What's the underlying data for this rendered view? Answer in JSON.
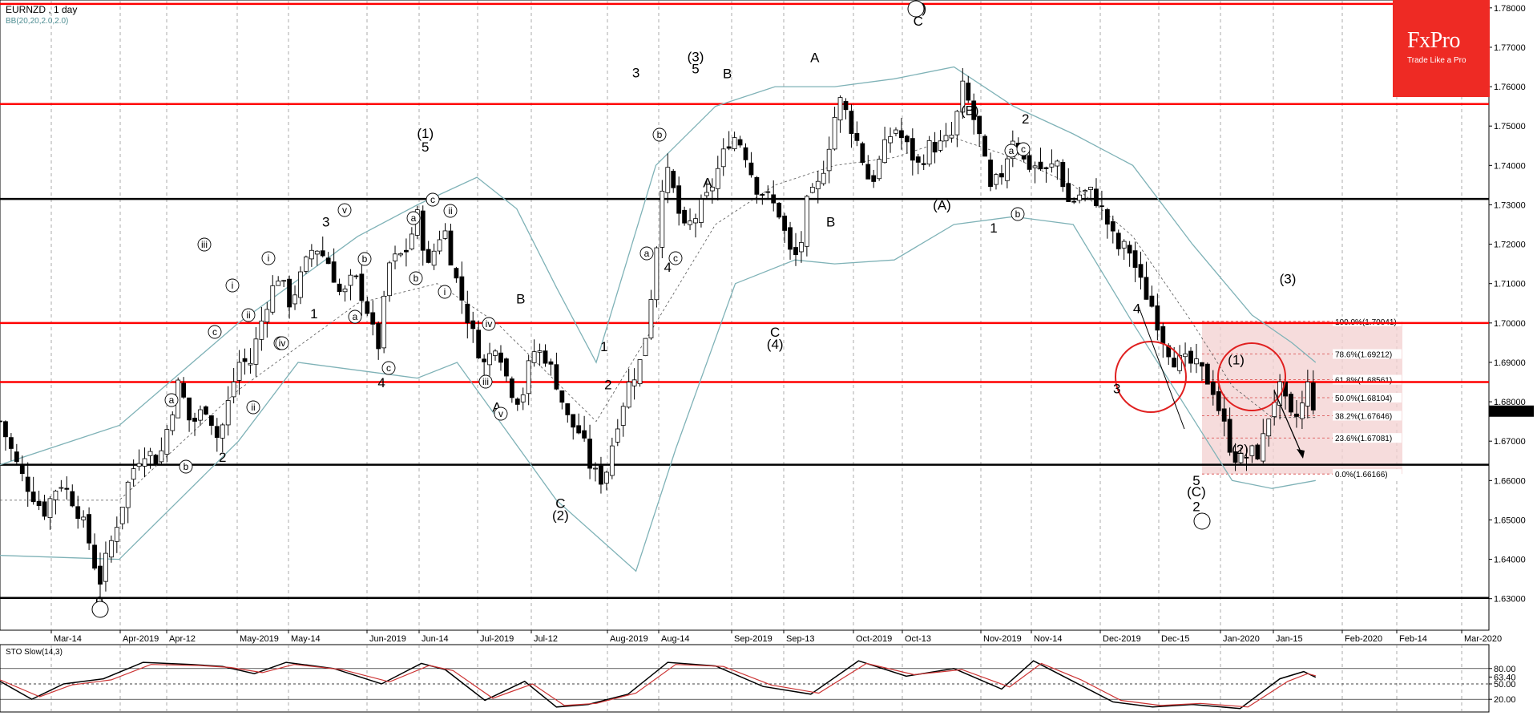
{
  "header": {
    "title": "EURNZD , 1 day",
    "indicator": "BB(20,20,2.0,2.0)"
  },
  "logo": {
    "brand": "FxPro",
    "tagline": "Trade Like a Pro"
  },
  "colors": {
    "bull": "#ffffff",
    "bear": "#000000",
    "bollinger": "#7fb2b7",
    "midline": "#555555",
    "resistance": "#ff0000",
    "support": "#000000",
    "fib_zone": "#f3d0d0",
    "stoch_k": "#000000",
    "stoch_d": "#cc3333",
    "logo_bg": "#ee2a24",
    "current_price_bg": "#000000"
  },
  "chart_data": [
    {
      "type": "candlestick",
      "title": "EURNZD , 1 day",
      "xlabel": "",
      "ylabel": "",
      "x_tick_labels": [
        "Mar-14",
        "Apr-2019",
        "Apr-12",
        "May-2019",
        "May-14",
        "Jun-2019",
        "Jun-14",
        "Jul-2019",
        "Jul-12",
        "Aug-2019",
        "Aug-14",
        "Sep-2019",
        "Sep-13",
        "Oct-2019",
        "Oct-13",
        "Nov-2019",
        "Nov-14",
        "Dec-2019",
        "Dec-15",
        "Jan-2020",
        "Jan-15",
        "Feb-2020",
        "Feb-14",
        "Mar-2020"
      ],
      "y_tick_labels": [
        "1.78000",
        "1.77000",
        "1.76000",
        "1.75000",
        "1.74000",
        "1.73000",
        "1.72000",
        "1.71000",
        "1.70000",
        "1.69000",
        "1.68000",
        "1.67000",
        "1.66000",
        "1.65000",
        "1.64000",
        "1.63000"
      ],
      "ylim": [
        1.622,
        1.782
      ],
      "current_price": "1.67762",
      "grid": true,
      "red_levels": [
        1.781,
        1.7556,
        1.7,
        1.685
      ],
      "black_levels": [
        1.7315,
        1.664,
        1.6302
      ],
      "close_path": [
        [
          0,
          1.675
        ],
        [
          5,
          1.662
        ],
        [
          11,
          1.652
        ],
        [
          15,
          1.66
        ],
        [
          19,
          1.654
        ],
        [
          22,
          1.646
        ],
        [
          25,
          1.634
        ],
        [
          29,
          1.648
        ],
        [
          33,
          1.662
        ],
        [
          36,
          1.668
        ],
        [
          40,
          1.665
        ],
        [
          45,
          1.685
        ],
        [
          48,
          1.674
        ],
        [
          52,
          1.679
        ],
        [
          55,
          1.67
        ],
        [
          60,
          1.69
        ],
        [
          63,
          1.69
        ],
        [
          67,
          1.705
        ],
        [
          70,
          1.712
        ],
        [
          73,
          1.705
        ],
        [
          77,
          1.715
        ],
        [
          79,
          1.72
        ],
        [
          83,
          1.715
        ],
        [
          86,
          1.706
        ],
        [
          89,
          1.712
        ],
        [
          92,
          1.705
        ],
        [
          95,
          1.693
        ],
        [
          98,
          1.715
        ],
        [
          102,
          1.718
        ],
        [
          105,
          1.727
        ],
        [
          108,
          1.713
        ],
        [
          110,
          1.722
        ],
        [
          112,
          1.723
        ],
        [
          115,
          1.71
        ],
        [
          119,
          1.697
        ],
        [
          122,
          1.689
        ],
        [
          125,
          1.696
        ],
        [
          128,
          1.684
        ],
        [
          131,
          1.68
        ],
        [
          134,
          1.693
        ],
        [
          137,
          1.692
        ],
        [
          140,
          1.685
        ],
        [
          143,
          1.675
        ],
        [
          146,
          1.672
        ],
        [
          149,
          1.662
        ],
        [
          152,
          1.66
        ],
        [
          155,
          1.674
        ],
        [
          158,
          1.684
        ],
        [
          161,
          1.69
        ],
        [
          163,
          1.7
        ],
        [
          165,
          1.718
        ],
        [
          167,
          1.74
        ],
        [
          169,
          1.735
        ],
        [
          172,
          1.723
        ],
        [
          175,
          1.727
        ],
        [
          178,
          1.732
        ],
        [
          181,
          1.74
        ],
        [
          184,
          1.748
        ],
        [
          187,
          1.745
        ],
        [
          190,
          1.735
        ],
        [
          193,
          1.732
        ],
        [
          196,
          1.728
        ],
        [
          199,
          1.717
        ],
        [
          201,
          1.717
        ],
        [
          203,
          1.73
        ],
        [
          206,
          1.735
        ],
        [
          208,
          1.743
        ],
        [
          211,
          1.757
        ],
        [
          213,
          1.753
        ],
        [
          216,
          1.745
        ],
        [
          219,
          1.735
        ],
        [
          222,
          1.743
        ],
        [
          225,
          1.75
        ],
        [
          228,
          1.745
        ],
        [
          231,
          1.74
        ],
        [
          234,
          1.745
        ],
        [
          237,
          1.745
        ],
        [
          240,
          1.748
        ],
        [
          242,
          1.76
        ],
        [
          244,
          1.755
        ],
        [
          247,
          1.745
        ],
        [
          249,
          1.733
        ],
        [
          252,
          1.738
        ],
        [
          255,
          1.748
        ],
        [
          258,
          1.74
        ],
        [
          261,
          1.74
        ],
        [
          263,
          1.738
        ],
        [
          266,
          1.741
        ],
        [
          269,
          1.73
        ],
        [
          272,
          1.733
        ],
        [
          275,
          1.733
        ],
        [
          278,
          1.727
        ],
        [
          281,
          1.719
        ],
        [
          284,
          1.719
        ],
        [
          287,
          1.71
        ],
        [
          290,
          1.704
        ],
        [
          293,
          1.695
        ],
        [
          296,
          1.69
        ],
        [
          299,
          1.69
        ],
        [
          302,
          1.688
        ],
        [
          305,
          1.684
        ],
        [
          307,
          1.677
        ],
        [
          310,
          1.667
        ],
        [
          312,
          1.665
        ],
        [
          315,
          1.667
        ],
        [
          317,
          1.667
        ],
        [
          320,
          1.68
        ],
        [
          322,
          1.683
        ],
        [
          325,
          1.675
        ],
        [
          327,
          1.677
        ],
        [
          329,
          1.684
        ],
        [
          331,
          1.6776
        ]
      ],
      "bollinger_upper": [
        [
          0,
          1.664
        ],
        [
          30,
          1.674
        ],
        [
          60,
          1.7
        ],
        [
          90,
          1.722
        ],
        [
          105,
          1.73
        ],
        [
          120,
          1.737
        ],
        [
          130,
          1.729
        ],
        [
          140,
          1.709
        ],
        [
          150,
          1.69
        ],
        [
          165,
          1.74
        ],
        [
          180,
          1.755
        ],
        [
          195,
          1.76
        ],
        [
          210,
          1.76
        ],
        [
          225,
          1.762
        ],
        [
          240,
          1.765
        ],
        [
          255,
          1.755
        ],
        [
          270,
          1.748
        ],
        [
          285,
          1.74
        ],
        [
          300,
          1.72
        ],
        [
          315,
          1.702
        ],
        [
          325,
          1.695
        ],
        [
          331,
          1.69
        ]
      ],
      "bollinger_lower": [
        [
          0,
          1.641
        ],
        [
          30,
          1.64
        ],
        [
          45,
          1.655
        ],
        [
          60,
          1.67
        ],
        [
          75,
          1.69
        ],
        [
          90,
          1.688
        ],
        [
          105,
          1.686
        ],
        [
          115,
          1.69
        ],
        [
          125,
          1.676
        ],
        [
          140,
          1.655
        ],
        [
          160,
          1.637
        ],
        [
          170,
          1.668
        ],
        [
          185,
          1.71
        ],
        [
          200,
          1.716
        ],
        [
          210,
          1.715
        ],
        [
          225,
          1.716
        ],
        [
          240,
          1.725
        ],
        [
          255,
          1.727
        ],
        [
          270,
          1.725
        ],
        [
          285,
          1.7
        ],
        [
          300,
          1.676
        ],
        [
          310,
          1.66
        ],
        [
          320,
          1.658
        ],
        [
          331,
          1.66
        ]
      ],
      "bollinger_middle": [
        [
          0,
          1.655
        ],
        [
          30,
          1.655
        ],
        [
          60,
          1.683
        ],
        [
          90,
          1.705
        ],
        [
          110,
          1.71
        ],
        [
          125,
          1.7
        ],
        [
          140,
          1.685
        ],
        [
          150,
          1.675
        ],
        [
          165,
          1.7
        ],
        [
          180,
          1.725
        ],
        [
          195,
          1.735
        ],
        [
          210,
          1.74
        ],
        [
          225,
          1.742
        ],
        [
          240,
          1.747
        ],
        [
          255,
          1.742
        ],
        [
          270,
          1.735
        ],
        [
          285,
          1.722
        ],
        [
          300,
          1.7
        ],
        [
          310,
          1.684
        ],
        [
          320,
          1.676
        ],
        [
          331,
          1.676
        ]
      ]
    },
    {
      "type": "line",
      "title": "STO Slow(14,3)",
      "y_tick_labels": [
        "80.00",
        "63.40",
        "50.00",
        "20.00"
      ],
      "ylim": [
        0,
        100
      ],
      "current_value": "63.40",
      "series": [
        {
          "name": "%K",
          "values": [
            [
              0,
              55
            ],
            [
              8,
              20
            ],
            [
              16,
              50
            ],
            [
              26,
              60
            ],
            [
              36,
              92
            ],
            [
              48,
              88
            ],
            [
              56,
              84
            ],
            [
              64,
              70
            ],
            [
              72,
              92
            ],
            [
              84,
              80
            ],
            [
              96,
              50
            ],
            [
              106,
              90
            ],
            [
              112,
              78
            ],
            [
              122,
              18
            ],
            [
              132,
              55
            ],
            [
              140,
              5
            ],
            [
              148,
              10
            ],
            [
              158,
              30
            ],
            [
              168,
              92
            ],
            [
              180,
              85
            ],
            [
              192,
              45
            ],
            [
              204,
              30
            ],
            [
              216,
              95
            ],
            [
              228,
              65
            ],
            [
              240,
              80
            ],
            [
              252,
              40
            ],
            [
              260,
              95
            ],
            [
              270,
              55
            ],
            [
              280,
              15
            ],
            [
              290,
              5
            ],
            [
              300,
              10
            ],
            [
              312,
              2
            ],
            [
              322,
              60
            ],
            [
              328,
              74
            ],
            [
              331,
              63
            ]
          ]
        },
        {
          "name": "%D",
          "values": [
            [
              0,
              58
            ],
            [
              10,
              25
            ],
            [
              18,
              48
            ],
            [
              28,
              58
            ],
            [
              38,
              88
            ],
            [
              50,
              86
            ],
            [
              58,
              82
            ],
            [
              66,
              72
            ],
            [
              74,
              88
            ],
            [
              86,
              78
            ],
            [
              98,
              54
            ],
            [
              108,
              86
            ],
            [
              114,
              76
            ],
            [
              124,
              22
            ],
            [
              134,
              50
            ],
            [
              142,
              8
            ],
            [
              150,
              12
            ],
            [
              160,
              32
            ],
            [
              170,
              88
            ],
            [
              182,
              84
            ],
            [
              194,
              48
            ],
            [
              206,
              32
            ],
            [
              218,
              90
            ],
            [
              230,
              68
            ],
            [
              242,
              78
            ],
            [
              254,
              44
            ],
            [
              262,
              90
            ],
            [
              272,
              58
            ],
            [
              282,
              18
            ],
            [
              292,
              8
            ],
            [
              302,
              12
            ],
            [
              314,
              5
            ],
            [
              324,
              55
            ],
            [
              329,
              70
            ],
            [
              331,
              66
            ]
          ]
        }
      ]
    }
  ],
  "wave_labels": [
    {
      "t": "1",
      "d": 79,
      "p": 1.7012
    },
    {
      "t": "1",
      "d": 231,
      "p": 1.7819
    },
    {
      "t": "(5)",
      "d": 231,
      "p": 1.7787
    },
    {
      "t": "C",
      "d": 231,
      "p": 1.7755
    },
    {
      "t": "(3)",
      "d": 175,
      "p": 1.7664
    },
    {
      "t": "5",
      "d": 175,
      "p": 1.7634
    },
    {
      "t": "B",
      "d": 183,
      "p": 1.7622
    },
    {
      "t": "3",
      "d": 160,
      "p": 1.7624
    },
    {
      "t": "A",
      "d": 205,
      "p": 1.7662
    },
    {
      "t": "(B)",
      "d": 244,
      "p": 1.7528
    },
    {
      "t": "2",
      "d": 258,
      "p": 1.7507
    },
    {
      "t": "3",
      "d": 82,
      "p": 1.7245
    },
    {
      "t": "(1)",
      "d": 107,
      "p": 1.747
    },
    {
      "t": "5",
      "d": 107,
      "p": 1.7435
    },
    {
      "t": "B",
      "d": 131,
      "p": 1.705
    },
    {
      "t": "2",
      "d": 56,
      "p": 1.6647
    },
    {
      "t": "1",
      "d": 152,
      "p": 1.6928
    },
    {
      "t": "2",
      "d": 153,
      "p": 1.6832
    },
    {
      "t": "4",
      "d": 96,
      "p": 1.6837
    },
    {
      "t": "A",
      "d": 125,
      "p": 1.6775
    },
    {
      "t": "C",
      "d": 141,
      "p": 1.653
    },
    {
      "t": "(2)",
      "d": 141,
      "p": 1.65
    },
    {
      "t": "4",
      "d": 168,
      "p": 1.713
    },
    {
      "t": "A",
      "d": 178,
      "p": 1.7345
    },
    {
      "t": "B",
      "d": 209,
      "p": 1.7245
    },
    {
      "t": "C",
      "d": 195,
      "p": 1.6965
    },
    {
      "t": "(4)",
      "d": 195,
      "p": 1.6935
    },
    {
      "t": "(A)",
      "d": 237,
      "p": 1.7288
    },
    {
      "t": "1",
      "d": 250,
      "p": 1.723
    },
    {
      "t": "4",
      "d": 286,
      "p": 1.7025
    },
    {
      "t": "3",
      "d": 281,
      "p": 1.6822
    },
    {
      "t": "5",
      "d": 301,
      "p": 1.6588
    },
    {
      "t": "(C)",
      "d": 301,
      "p": 1.656
    },
    {
      "t": "2",
      "d": 301,
      "p": 1.6522
    },
    {
      "t": "(1)",
      "d": 311,
      "p": 1.6895
    },
    {
      "t": "(2)",
      "d": 312,
      "p": 1.6668
    },
    {
      "t": "(3)",
      "d": 324,
      "p": 1.71
    },
    {
      "t": "0",
      "d": 25,
      "p": 1.6282
    }
  ],
  "fib_levels": [
    {
      "label": "100.0%(1.70041)",
      "p": 1.70041
    },
    {
      "label": "78.6%(1.69212)",
      "p": 1.69212
    },
    {
      "label": "61.8%(1.68561)",
      "p": 1.68561
    },
    {
      "label": "50.0%(1.68104)",
      "p": 1.68104
    },
    {
      "label": "38.2%(1.67646)",
      "p": 1.67646
    },
    {
      "label": "23.6%(1.67081)",
      "p": 1.67081
    },
    {
      "label": "0.0%(1.66166)",
      "p": 1.66166
    }
  ]
}
